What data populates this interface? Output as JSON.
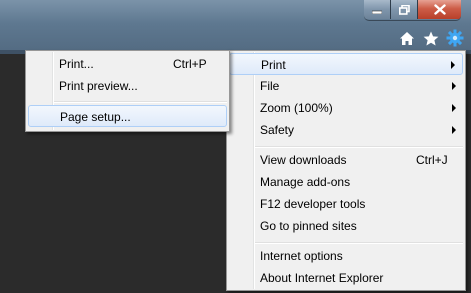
{
  "window": {
    "minimize_label": "minimize",
    "maximize_label": "maximize",
    "close_label": "close"
  },
  "toolbar": {
    "icons": [
      "home-icon",
      "star-icon",
      "gear-icon"
    ]
  },
  "tools_menu": {
    "items": [
      {
        "label": "Print",
        "submenu": true
      },
      {
        "label": "File",
        "submenu": true
      },
      {
        "label": "Zoom (100%)",
        "submenu": true
      },
      {
        "label": "Safety",
        "submenu": true
      },
      {
        "label": "View downloads",
        "shortcut": "Ctrl+J"
      },
      {
        "label": "Manage add-ons"
      },
      {
        "label": "F12 developer tools"
      },
      {
        "label": "Go to pinned sites"
      },
      {
        "label": "Internet options"
      },
      {
        "label": "About Internet Explorer"
      }
    ]
  },
  "print_submenu": {
    "items": [
      {
        "label": "Print...",
        "shortcut": "Ctrl+P"
      },
      {
        "label": "Print preview..."
      },
      {
        "label": "Page setup..."
      }
    ]
  },
  "colors": {
    "highlight_border": "#aecff7",
    "menu_background": "#f0f0f0",
    "content_background": "#2b2b2b"
  }
}
